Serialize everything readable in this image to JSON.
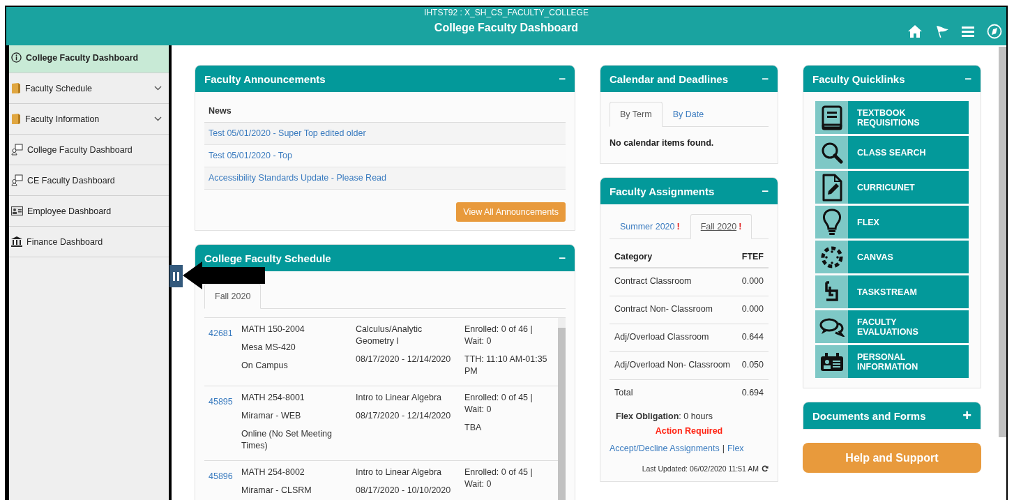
{
  "header": {
    "subtitle": "IHTST92 : X_SH_CS_FACULTY_COLLEGE",
    "title": "College Faculty Dashboard"
  },
  "sidebar": {
    "items": [
      {
        "label": "College Faculty Dashboard",
        "kind": "info",
        "selected": true
      },
      {
        "label": "Faculty Schedule",
        "kind": "folder",
        "selected": false
      },
      {
        "label": "Faculty Information",
        "kind": "folder",
        "selected": false
      },
      {
        "label": "College Faculty Dashboard",
        "kind": "dashboard",
        "selected": false
      },
      {
        "label": "CE Faculty Dashboard",
        "kind": "dashboard",
        "selected": false
      },
      {
        "label": "Employee Dashboard",
        "kind": "employee",
        "selected": false
      },
      {
        "label": "Finance Dashboard",
        "kind": "finance",
        "selected": false
      }
    ]
  },
  "announcements": {
    "title": "Faculty Announcements",
    "toggle": "–",
    "column": "News",
    "items": [
      "Test 05/01/2020 - Super Top edited older",
      "Test 05/01/2020 - Top",
      "Accessibility Standards Update - Please Read"
    ],
    "button": "View All Announcements"
  },
  "schedule": {
    "title": "College Faculty Schedule",
    "toggle": "–",
    "tabs": [
      {
        "label": "Fall 2020",
        "selected": true
      }
    ],
    "rows": [
      {
        "class_number": "42681",
        "course": "MATH 150-2004",
        "location": "Mesa MS-420",
        "mode": "On Campus",
        "title": "Calculus/Analytic Geometry I",
        "dates": "08/17/2020 - 12/14/2020",
        "enrollment": "Enrolled: 0 of 46 | Wait: 0",
        "meeting": "TTH: 11:10 AM-01:35 PM"
      },
      {
        "class_number": "45895",
        "course": "MATH 254-8001",
        "location": "Miramar - WEB",
        "mode": "Online (No Set Meeting Times)",
        "title": "Intro to Linear Algebra",
        "dates": "08/17/2020 - 12/14/2020",
        "enrollment": "Enrolled: 0 of 45 | Wait: 0",
        "meeting": "TBA"
      },
      {
        "class_number": "45896",
        "course": "MATH 254-8002",
        "location": "Miramar - CLSRM",
        "title": "Intro to Linear Algebra",
        "dates": "08/17/2020 - 10/10/2020",
        "enrollment": "Enrolled: 0 of 45 | Wait: 0"
      }
    ]
  },
  "calendar": {
    "title": "Calendar and Deadlines",
    "toggle": "–",
    "tabs": [
      {
        "label": "By Term",
        "selected": true
      },
      {
        "label": "By Date",
        "selected": false
      }
    ],
    "message": "No calendar items found."
  },
  "assignments": {
    "title": "Faculty Assignments",
    "toggle": "–",
    "tabs": [
      {
        "label": "Summer 2020",
        "alert": "!",
        "selected": false
      },
      {
        "label": "Fall 2020",
        "alert": "!",
        "selected": true
      }
    ],
    "columns": [
      "Category",
      "FTEF"
    ],
    "rows": [
      {
        "category": "Contract Classroom",
        "ftef": "0.000"
      },
      {
        "category": "Contract Non- Classroom",
        "ftef": "0.000"
      },
      {
        "category": "Adj/Overload Classroom",
        "ftef": "0.644"
      },
      {
        "category": "Adj/Overload Non- Classroom",
        "ftef": "0.050"
      },
      {
        "category": "Total",
        "ftef": "0.694"
      }
    ],
    "flex": "**Flex Obligation**: 0 hours",
    "action": "Action Required",
    "links": [
      "Accept/Decline Assignments",
      "Flex"
    ],
    "separator": "|",
    "last_updated": "Last Updated: 06/02/2020 11:51 AM"
  },
  "quicklinks": {
    "title": "Faculty Quicklinks",
    "toggle": "–",
    "items": [
      {
        "label": "TEXTBOOK REQUISITIONS",
        "kind": "book"
      },
      {
        "label": "CLASS SEARCH",
        "kind": "search"
      },
      {
        "label": "CURRICUNET",
        "kind": "document"
      },
      {
        "label": "FLEX",
        "kind": "bulb"
      },
      {
        "label": "CANVAS",
        "kind": "circle"
      },
      {
        "label": "TASKSTREAM",
        "kind": "stream"
      },
      {
        "label": "FACULTY EVALUATIONS",
        "kind": "chat"
      },
      {
        "label": "PERSONAL INFORMATION",
        "kind": "idcard"
      }
    ]
  },
  "documents": {
    "title": "Documents and Forms",
    "toggle": "+"
  },
  "help": {
    "label": "Help and Support"
  }
}
